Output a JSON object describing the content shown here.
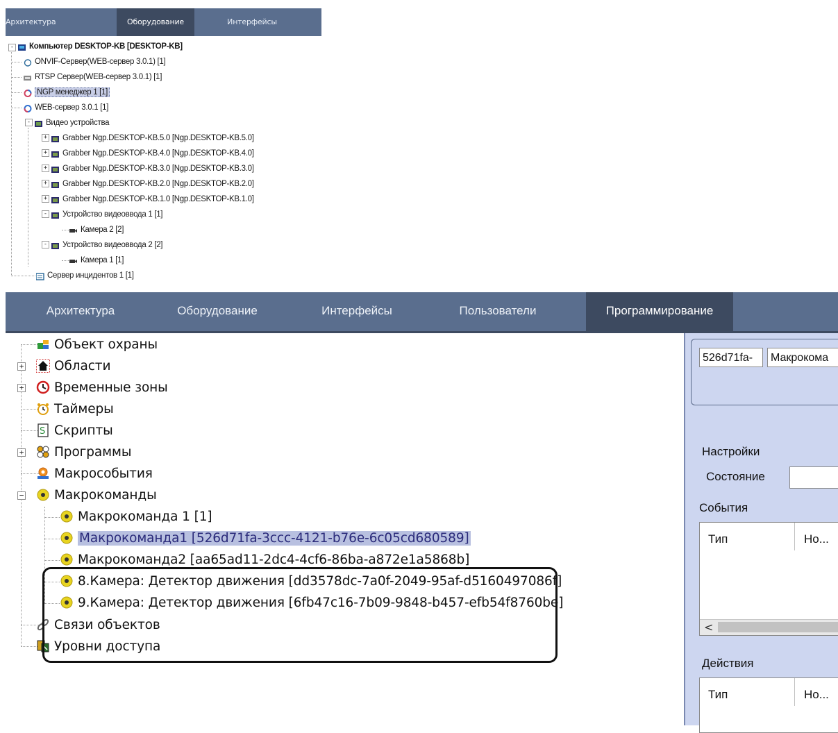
{
  "top_window": {
    "tabs": [
      "Архитектура",
      "Оборудование",
      "Интерфейсы"
    ],
    "active_tab": 1,
    "tree": [
      {
        "label": "Компьютер DESKTOP-KB [DESKTOP-KB]",
        "icon": "computer-icon"
      },
      {
        "label": "ONVIF-Сервер(WEB-сервер 3.0.1) [1]",
        "icon": "onvif-icon"
      },
      {
        "label": "RTSP Сервер(WEB-сервер 3.0.1) [1]",
        "icon": "rtsp-icon"
      },
      {
        "label": "NGP менеджер 1 [1]",
        "icon": "ngp-icon",
        "selected": true
      },
      {
        "label": "WEB-сервер 3.0.1 [1]",
        "icon": "web-icon"
      },
      {
        "label": "Видео устройства",
        "icon": "video-devices-icon"
      },
      {
        "label": "Grabber Ngp.DESKTOP-KB.5.0 [Ngp.DESKTOP-KB.5.0]",
        "icon": "grabber-icon"
      },
      {
        "label": "Grabber Ngp.DESKTOP-KB.4.0 [Ngp.DESKTOP-KB.4.0]",
        "icon": "grabber-icon"
      },
      {
        "label": "Grabber Ngp.DESKTOP-KB.3.0 [Ngp.DESKTOP-KB.3.0]",
        "icon": "grabber-icon"
      },
      {
        "label": "Grabber Ngp.DESKTOP-KB.2.0 [Ngp.DESKTOP-KB.2.0]",
        "icon": "grabber-icon"
      },
      {
        "label": "Grabber Ngp.DESKTOP-KB.1.0 [Ngp.DESKTOP-KB.1.0]",
        "icon": "grabber-icon"
      },
      {
        "label": "Устройство видеоввода 1 [1]",
        "icon": "video-input-icon"
      },
      {
        "label": "Камера 2 [2]",
        "icon": "camera-icon"
      },
      {
        "label": "Устройство видеоввода 2 [2]",
        "icon": "video-input-icon"
      },
      {
        "label": "Камера 1 [1]",
        "icon": "camera-icon"
      },
      {
        "label": "Сервер инцидентов 1 [1]",
        "icon": "incident-server-icon"
      }
    ]
  },
  "main_window": {
    "tabs": [
      "Архитектура",
      "Оборудование",
      "Интерфейсы",
      "Пользователи",
      "Программирование"
    ],
    "active_tab": 4,
    "tree": [
      {
        "label": "Объект охраны",
        "icon": "object-icon"
      },
      {
        "label": "Области",
        "icon": "area-icon"
      },
      {
        "label": "Временные зоны",
        "icon": "clock-icon"
      },
      {
        "label": "Таймеры",
        "icon": "alarm-clock-icon"
      },
      {
        "label": "Скрипты",
        "icon": "script-icon"
      },
      {
        "label": "Программы",
        "icon": "program-icon"
      },
      {
        "label": "Макрособытия",
        "icon": "macro-event-icon"
      },
      {
        "label": "Макрокоманды",
        "icon": "macro-command-icon"
      },
      {
        "label": "Макрокоманда 1 [1]",
        "icon": "macro-command-icon"
      },
      {
        "label": "Макрокоманда1 [526d71fa-3ccc-4121-b76e-6c05cd680589]",
        "icon": "macro-command-icon",
        "selected": true
      },
      {
        "label": "Макрокоманда2 [aa65ad11-2dc4-4cf6-86ba-a872e1a5868b]",
        "icon": "macro-command-icon"
      },
      {
        "label": "8.Камера: Детектор движения [dd3578dc-7a0f-2049-95af-d5160497086f]",
        "icon": "macro-command-icon"
      },
      {
        "label": "9.Камера: Детектор движения [6fb47c16-7b09-9848-b457-efb54f8760be]",
        "icon": "macro-command-icon"
      },
      {
        "label": "Связи объектов",
        "icon": "link-icon"
      },
      {
        "label": "Уровни доступа",
        "icon": "access-level-icon"
      }
    ],
    "right_panel": {
      "id_field": "526d71fa-",
      "name_field": "Макрокома",
      "settings_label": "Настройки",
      "state_label": "Состояние",
      "events_label": "События",
      "events_columns": [
        "Тип",
        "Но..."
      ],
      "actions_label": "Действия",
      "actions_columns": [
        "Тип",
        "Но..."
      ],
      "scroll_left": "<"
    }
  }
}
